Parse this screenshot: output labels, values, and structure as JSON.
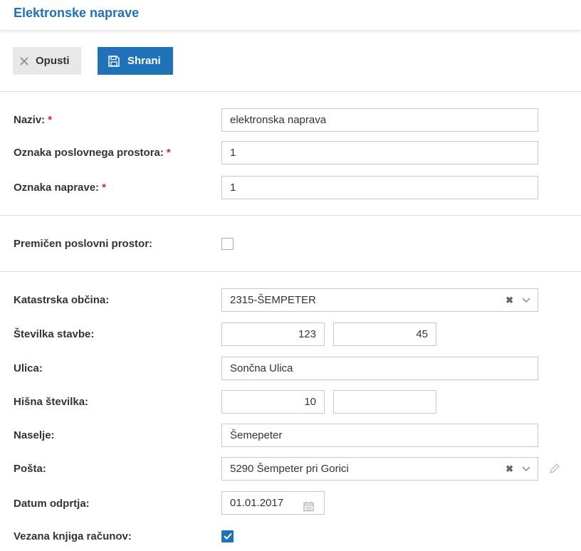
{
  "header": {
    "title": "Elektronske naprave"
  },
  "toolbar": {
    "cancel_label": "Opusti",
    "save_label": "Shrani",
    "cancel_icon": "close-icon",
    "save_icon": "save-icon"
  },
  "form": {
    "naziv": {
      "label": "Naziv:",
      "required": "*",
      "value": "elektronska naprava"
    },
    "oznaka_prostora": {
      "label": "Oznaka poslovnega prostora:",
      "required": "*",
      "value": "1"
    },
    "oznaka_naprave": {
      "label": "Oznaka naprave:",
      "required": "*",
      "value": "1"
    },
    "premicen": {
      "label": "Premičen poslovni prostor:",
      "checked": false
    },
    "katastrska": {
      "label": "Katastrska občina:",
      "value": "2315-ŠEMPETER"
    },
    "stevilka_stavbe": {
      "label": "Številka stavbe:",
      "value1": "123",
      "value2": "45"
    },
    "ulica": {
      "label": "Ulica:",
      "value": "Sončna Ulica"
    },
    "hisna": {
      "label": "Hišna številka:",
      "value1": "10",
      "value2": ""
    },
    "naselje": {
      "label": "Naselje:",
      "value": "Šemepeter"
    },
    "posta": {
      "label": "Pošta:",
      "value": "5290 Šempeter pri Gorici"
    },
    "datum": {
      "label": "Datum odprtja:",
      "value": "01.01.2017"
    },
    "vezana": {
      "label": "Vezana knjiga računov:",
      "checked": true
    }
  },
  "colors": {
    "accent": "#1f72b8",
    "required": "#d9232e",
    "border": "#c8c8c8"
  }
}
